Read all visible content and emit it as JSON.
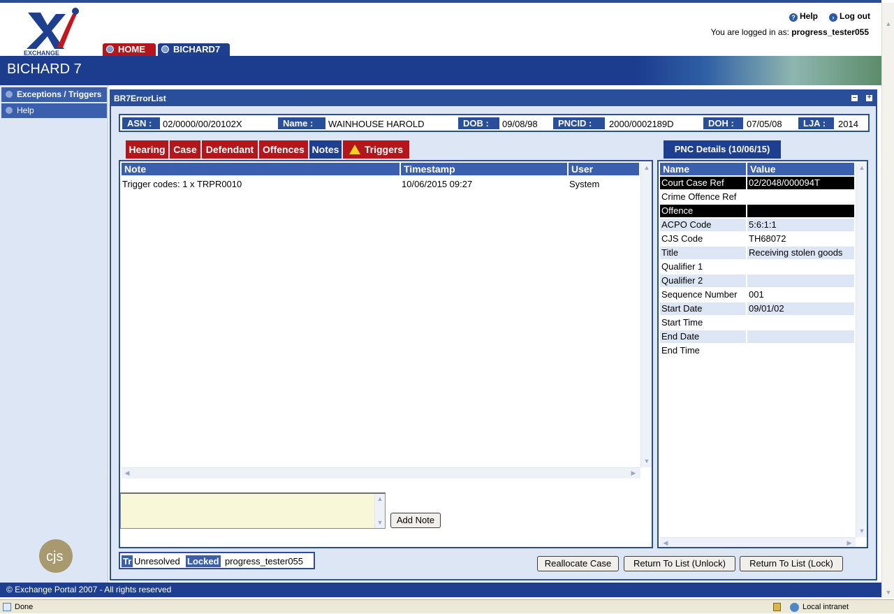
{
  "header": {
    "logo_text": "EXCHANGE",
    "tabs": [
      {
        "label": "HOME"
      },
      {
        "label": "BICHARD7"
      }
    ],
    "help_label": "Help",
    "logout_label": "Log out",
    "logged_in_prefix": "You are logged in as:",
    "username": "progress_tester055",
    "banner_title": "BICHARD 7"
  },
  "sidebar": {
    "items": [
      {
        "label": "Exceptions / Triggers"
      },
      {
        "label": "Help"
      }
    ],
    "cjs_logo_text": "cjs"
  },
  "panel": {
    "title": "BR7ErrorList",
    "minimize_symbol": "–",
    "maximize_symbol": "+"
  },
  "case_info": {
    "asn_label": "ASN :",
    "asn": "02/0000/00/20102X",
    "name_label": "Name :",
    "name": "WAINHOUSE HAROLD",
    "dob_label": "DOB :",
    "dob": "09/08/98",
    "pncid_label": "PNCID :",
    "pncid": "2000/0002189D",
    "doh_label": "DOH :",
    "doh": "07/05/08",
    "lja_label": "LJA :",
    "lja": "2014"
  },
  "tabs": [
    {
      "label": "Hearing"
    },
    {
      "label": "Case"
    },
    {
      "label": "Defendant"
    },
    {
      "label": "Offences"
    },
    {
      "label": "Notes"
    },
    {
      "label": "Triggers"
    }
  ],
  "active_tab": "Notes",
  "notes": {
    "columns": [
      "Note",
      "Timestamp",
      "User"
    ],
    "rows": [
      {
        "note": "Trigger codes: 1 x TRPR0010",
        "timestamp": "10/06/2015 09:27",
        "user": "System"
      }
    ],
    "input_value": "",
    "add_button": "Add Note"
  },
  "pnc": {
    "tab_label": "PNC Details (10/06/15)",
    "columns": [
      "Name",
      "Value"
    ],
    "rows": [
      {
        "name": "Court Case Ref",
        "value": "02/2048/000094T"
      },
      {
        "name": "Crime Offence Ref",
        "value": ""
      },
      {
        "name": "Offence",
        "value": ""
      },
      {
        "name": "ACPO Code",
        "value": "5:6:1:1"
      },
      {
        "name": "CJS Code",
        "value": "TH68072"
      },
      {
        "name": "Title",
        "value": "Receiving stolen goods"
      },
      {
        "name": "Qualifier 1",
        "value": ""
      },
      {
        "name": "Qualifier 2",
        "value": ""
      },
      {
        "name": "Sequence Number",
        "value": "001"
      },
      {
        "name": "Start Date",
        "value": "09/01/02"
      },
      {
        "name": "Start Time",
        "value": ""
      },
      {
        "name": "End Date",
        "value": ""
      },
      {
        "name": "End Time",
        "value": ""
      }
    ]
  },
  "status": {
    "tr_label": "Tr",
    "tr_value": "Unresolved",
    "locked_label": "Locked",
    "locked_value": "progress_tester055"
  },
  "actions": {
    "reallocate": "Reallocate Case",
    "return_unlock": "Return To List (Unlock)",
    "return_lock": "Return To List (Lock)"
  },
  "footer": {
    "copyright": "© Exchange Portal 2007 - All rights reserved"
  },
  "browser_status": {
    "left": "Done",
    "zone": "Local intranet"
  },
  "colors": {
    "navy": "#1e3f8f",
    "red": "#b5151b",
    "panel_bg": "#dde6f5"
  }
}
